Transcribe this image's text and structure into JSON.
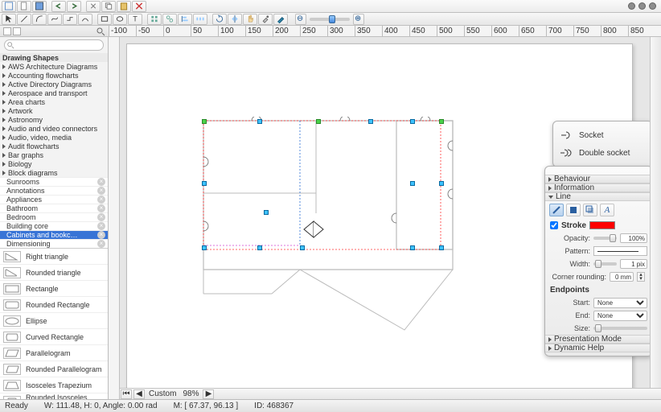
{
  "ruler": {
    "ticks": [
      "-100",
      "-50",
      "0",
      "50",
      "100",
      "150",
      "200",
      "250",
      "300",
      "350",
      "400",
      "450",
      "500",
      "550",
      "600",
      "650",
      "700",
      "750",
      "800",
      "850"
    ]
  },
  "sidebar": {
    "search_placeholder": "",
    "header": "Drawing Shapes",
    "categories": [
      "AWS Architecture Diagrams",
      "Accounting flowcharts",
      "Active Directory Diagrams",
      "Aerospace and transport",
      "Area charts",
      "Artwork",
      "Astronomy",
      "Audio and video connectors",
      "Audio, video, media",
      "Audit flowcharts",
      "Bar graphs",
      "Biology",
      "Block diagrams"
    ],
    "subcategories": [
      "Sunrooms",
      "Annotations",
      "Appliances",
      "Bathroom",
      "Bedroom",
      "Building core",
      "Cabinets and bookc…",
      "Dimensioning"
    ],
    "selected_sub_index": 6,
    "shapes": [
      "Right triangle",
      "Rounded triangle",
      "Rectangle",
      "Rounded Rectangle",
      "Ellipse",
      "Curved Rectangle",
      "Parallelogram",
      "Rounded Parallelogram",
      "Isosceles Trapezium",
      "Rounded Isosceles Trapezium"
    ]
  },
  "sockets_panel": {
    "items": [
      "Socket",
      "Double socket"
    ]
  },
  "props_panel": {
    "sections": {
      "behaviour": "Behaviour",
      "information": "Information",
      "line": "Line",
      "presentation": "Presentation Mode",
      "help": "Dynamic Help"
    },
    "stroke_label": "Stroke",
    "stroke_color": "#ff0000",
    "opacity_label": "Opacity:",
    "opacity_value": "100%",
    "pattern_label": "Pattern:",
    "width_label": "Width:",
    "width_value": "1 pix",
    "corner_label": "Corner rounding:",
    "corner_value": "0 mm",
    "endpoints_label": "Endpoints",
    "start_label": "Start:",
    "start_value": "None",
    "end_label": "End:",
    "end_value": "None",
    "size_label": "Size:"
  },
  "hscroll": {
    "zoom_mode": "Custom",
    "zoom_value": "98%"
  },
  "status": {
    "ready": "Ready",
    "dims": "W: 111.48, H: 0, Angle: 0.00 rad",
    "mouse": "M: [ 67.37, 96.13 ]",
    "id": "ID: 468367"
  }
}
